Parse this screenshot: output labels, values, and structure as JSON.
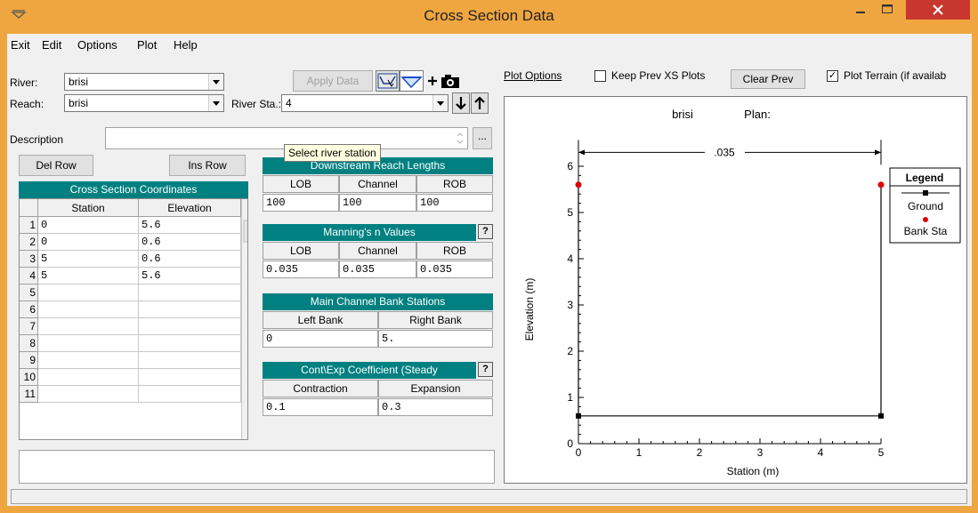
{
  "window": {
    "title": "Cross Section Data"
  },
  "menu": {
    "items": [
      "Exit",
      "Edit",
      "Options",
      "Plot",
      "Help"
    ]
  },
  "form": {
    "river_label": "River:",
    "river_value": "brisi",
    "reach_label": "Reach:",
    "reach_value": "brisi",
    "river_sta_label": "River Sta.:",
    "river_sta_value": "4",
    "description_label": "Description",
    "description_value": ""
  },
  "toolbar": {
    "apply_data": "Apply Data"
  },
  "tooltip": "Select river station",
  "buttons": {
    "del_row": "Del Row",
    "ins_row": "Ins Row"
  },
  "coords": {
    "title": "Cross Section Coordinates",
    "headers": [
      "Station",
      "Elevation"
    ],
    "row_numbers": [
      "1",
      "2",
      "3",
      "4",
      "5",
      "6",
      "7",
      "8",
      "9",
      "10",
      "11"
    ],
    "rows": [
      [
        "0",
        "5.6"
      ],
      [
        "0",
        "0.6"
      ],
      [
        "5",
        "0.6"
      ],
      [
        "5",
        "5.6"
      ],
      [
        "",
        ""
      ],
      [
        "",
        ""
      ],
      [
        "",
        ""
      ],
      [
        "",
        ""
      ],
      [
        "",
        ""
      ],
      [
        "",
        ""
      ],
      [
        "",
        ""
      ]
    ]
  },
  "reach_lengths": {
    "title": "Downstream Reach Lengths",
    "headers": [
      "LOB",
      "Channel",
      "ROB"
    ],
    "values": [
      "100",
      "100",
      "100"
    ]
  },
  "mannings": {
    "title": "Manning's n Values",
    "headers": [
      "LOB",
      "Channel",
      "ROB"
    ],
    "values": [
      "0.035",
      "0.035",
      "0.035"
    ]
  },
  "bank_stations": {
    "title": "Main Channel Bank Stations",
    "headers": [
      "Left Bank",
      "Right Bank"
    ],
    "values": [
      "0",
      "5."
    ]
  },
  "coefficients": {
    "title": "Cont\\Exp Coefficient (Steady",
    "headers": [
      "Contraction",
      "Expansion"
    ],
    "values": [
      "0.1",
      "0.3"
    ]
  },
  "plot_options": {
    "link": "Plot Options",
    "keep_prev": "Keep Prev XS Plots",
    "keep_prev_checked": false,
    "clear_prev": "Clear Prev",
    "plot_terrain": "Plot Terrain (if availab",
    "plot_terrain_checked": true
  },
  "chart_data": {
    "type": "line",
    "title_left": "brisi",
    "title_right": "Plan:",
    "xlabel": "Station (m)",
    "ylabel": "Elevation (m)",
    "xlim": [
      0,
      5
    ],
    "ylim": [
      0,
      6
    ],
    "xticks": [
      "0",
      "1",
      "2",
      "3",
      "4",
      "5"
    ],
    "yticks": [
      "0",
      "1",
      "2",
      "3",
      "4",
      "5",
      "6"
    ],
    "series": [
      {
        "name": "Ground",
        "x": [
          0,
          0,
          5,
          5
        ],
        "y": [
          5.6,
          0.6,
          0.6,
          5.6
        ],
        "color": "#000000"
      },
      {
        "name": "Bank Sta",
        "x": [
          0,
          5
        ],
        "y": [
          5.6,
          5.6
        ],
        "color": "#e00000"
      }
    ],
    "annotation": {
      "text": ".035",
      "x_from": 0,
      "x_to": 5,
      "y": 6.3
    },
    "legend": {
      "title": "Legend",
      "placement": "right"
    }
  }
}
